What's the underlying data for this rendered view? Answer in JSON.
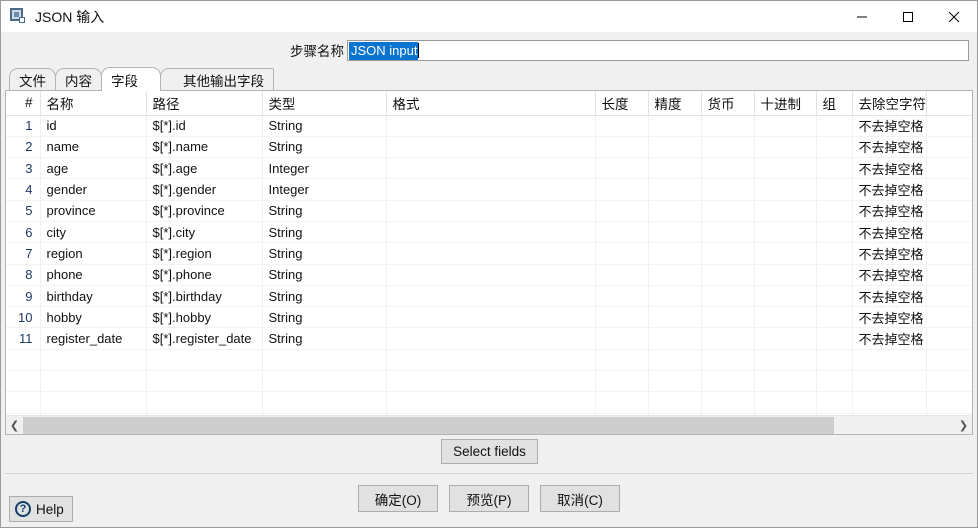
{
  "window": {
    "title": "JSON 输入",
    "icon": "json-input-icon",
    "controls": {
      "minimize": "minimize-icon",
      "maximize": "maximize-icon",
      "close": "close-icon"
    }
  },
  "step": {
    "label": "步骤名称",
    "value": "JSON input",
    "selected": true
  },
  "tabs": [
    {
      "label": "文件",
      "selected": false
    },
    {
      "label": "内容",
      "selected": false
    },
    {
      "label": "字段",
      "selected": true
    },
    {
      "label": "其他输出字段",
      "selected": false
    }
  ],
  "table": {
    "columns": [
      "#",
      "名称",
      "路径",
      "类型",
      "格式",
      "长度",
      "精度",
      "货币",
      "十进制",
      "组",
      "去除空字符串"
    ],
    "rows": [
      {
        "n": "1",
        "name": "id",
        "path": "$[*].id",
        "type": "String",
        "format": "",
        "length": "",
        "precision": "",
        "currency": "",
        "decimal": "",
        "group": "",
        "trim": "不去掉空格"
      },
      {
        "n": "2",
        "name": "name",
        "path": "$[*].name",
        "type": "String",
        "format": "",
        "length": "",
        "precision": "",
        "currency": "",
        "decimal": "",
        "group": "",
        "trim": "不去掉空格"
      },
      {
        "n": "3",
        "name": "age",
        "path": "$[*].age",
        "type": "Integer",
        "format": "",
        "length": "",
        "precision": "",
        "currency": "",
        "decimal": "",
        "group": "",
        "trim": "不去掉空格"
      },
      {
        "n": "4",
        "name": "gender",
        "path": "$[*].gender",
        "type": "Integer",
        "format": "",
        "length": "",
        "precision": "",
        "currency": "",
        "decimal": "",
        "group": "",
        "trim": "不去掉空格"
      },
      {
        "n": "5",
        "name": "province",
        "path": "$[*].province",
        "type": "String",
        "format": "",
        "length": "",
        "precision": "",
        "currency": "",
        "decimal": "",
        "group": "",
        "trim": "不去掉空格"
      },
      {
        "n": "6",
        "name": "city",
        "path": "$[*].city",
        "type": "String",
        "format": "",
        "length": "",
        "precision": "",
        "currency": "",
        "decimal": "",
        "group": "",
        "trim": "不去掉空格"
      },
      {
        "n": "7",
        "name": "region",
        "path": "$[*].region",
        "type": "String",
        "format": "",
        "length": "",
        "precision": "",
        "currency": "",
        "decimal": "",
        "group": "",
        "trim": "不去掉空格"
      },
      {
        "n": "8",
        "name": "phone",
        "path": "$[*].phone",
        "type": "String",
        "format": "",
        "length": "",
        "precision": "",
        "currency": "",
        "decimal": "",
        "group": "",
        "trim": "不去掉空格"
      },
      {
        "n": "9",
        "name": "birthday",
        "path": "$[*].birthday",
        "type": "String",
        "format": "",
        "length": "",
        "precision": "",
        "currency": "",
        "decimal": "",
        "group": "",
        "trim": "不去掉空格"
      },
      {
        "n": "10",
        "name": "hobby",
        "path": "$[*].hobby",
        "type": "String",
        "format": "",
        "length": "",
        "precision": "",
        "currency": "",
        "decimal": "",
        "group": "",
        "trim": "不去掉空格"
      },
      {
        "n": "11",
        "name": "register_date",
        "path": "$[*].register_date",
        "type": "String",
        "format": "",
        "length": "",
        "precision": "",
        "currency": "",
        "decimal": "",
        "group": "",
        "trim": "不去掉空格"
      }
    ],
    "empty_rows": 4
  },
  "scrollbar": {
    "left_arrow": "chevron-left-icon",
    "right_arrow": "chevron-right-icon",
    "thumb_ratio": "87%"
  },
  "actions": {
    "select_fields": "Select fields",
    "ok": "确定(O)",
    "preview": "预览(P)",
    "cancel": "取消(C)",
    "help": "Help",
    "help_icon": "question-mark-icon"
  },
  "colors": {
    "selection": "#0a74d1",
    "button_face": "#e1e1e1",
    "border": "#adadad",
    "row_number": "#1f3864"
  }
}
